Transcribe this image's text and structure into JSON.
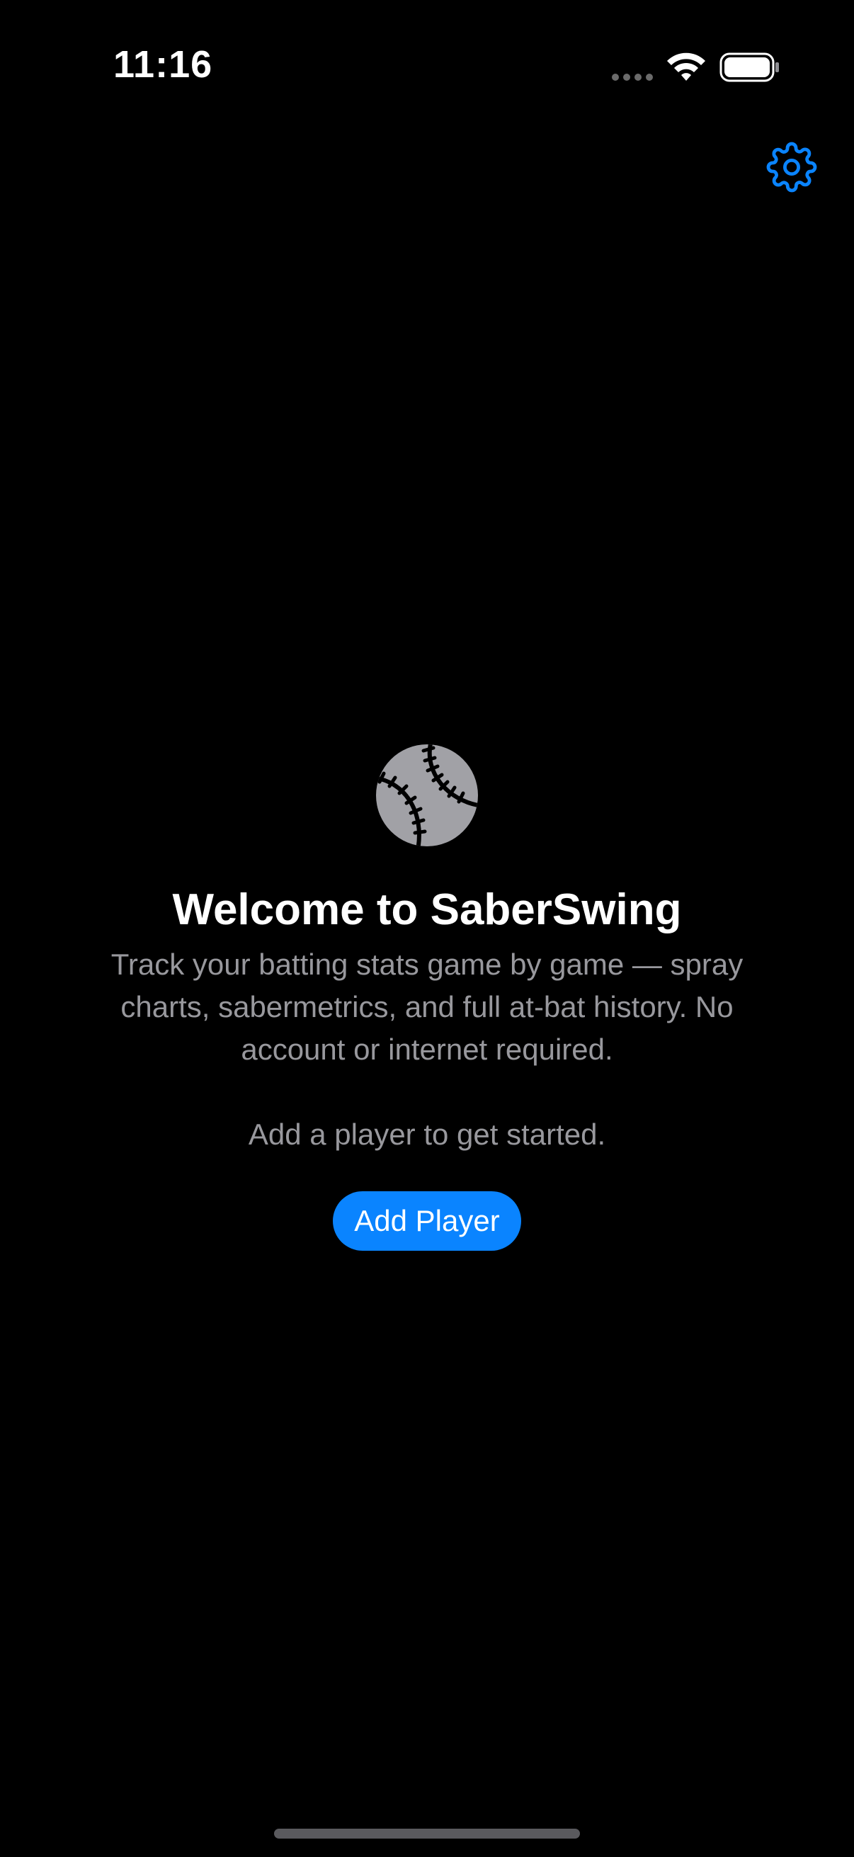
{
  "status_bar": {
    "time": "11:16",
    "wifi_icon": "wifi-icon",
    "battery_icon": "battery-icon"
  },
  "toolbar": {
    "settings_icon": "gear-icon"
  },
  "empty_state": {
    "icon": "baseball-icon",
    "title": "Welcome to SaberSwing",
    "description": "Track your batting stats game by game — spray charts, sabermetrics, and full at-bat history. No account or internet required.",
    "get_started": "Add a player to get started.",
    "add_player_label": "Add Player"
  },
  "colors": {
    "accent": "#0a84ff",
    "background": "#000000",
    "secondary_text": "#98989d",
    "icon_gray": "#a1a1a6"
  }
}
